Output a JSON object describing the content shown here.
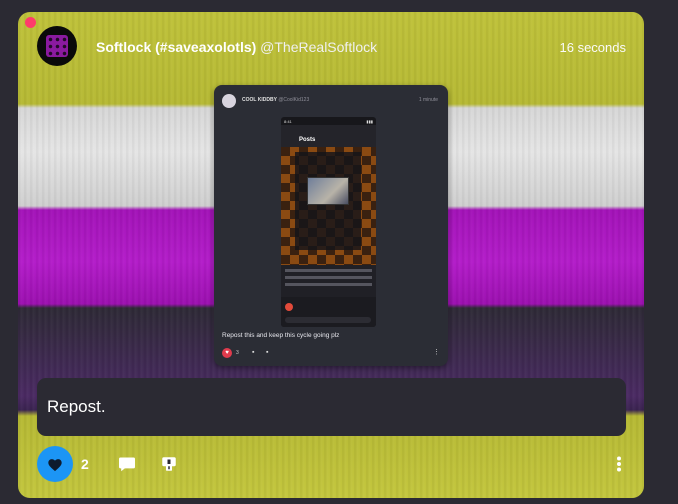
{
  "post": {
    "author_name": "Softlock (#saveaxolotls)",
    "author_handle": "@TheRealSoftlock",
    "timestamp": "16 seconds",
    "body": "Repost.",
    "like_count": "2",
    "liked": true,
    "avatar_icon": "purple-dotted-cube-icon"
  },
  "embed": {
    "author_name": "COOL KIDDBY",
    "author_handle": "@CoolKid123",
    "timestamp": "1 minute",
    "text": "Repost this and keep this cycle going plz",
    "like_count": "3",
    "phone": {
      "clock": "8:41",
      "header_title": "Posts"
    }
  },
  "colors": {
    "like_accent": "#1c95f5",
    "card_band_yellow": "#bfc23a",
    "card_band_white": "#e5e5e5",
    "card_band_purple": "#b31cc9",
    "card_band_dark": "#3f2a52",
    "notification_dot": "#ff3b6b"
  }
}
